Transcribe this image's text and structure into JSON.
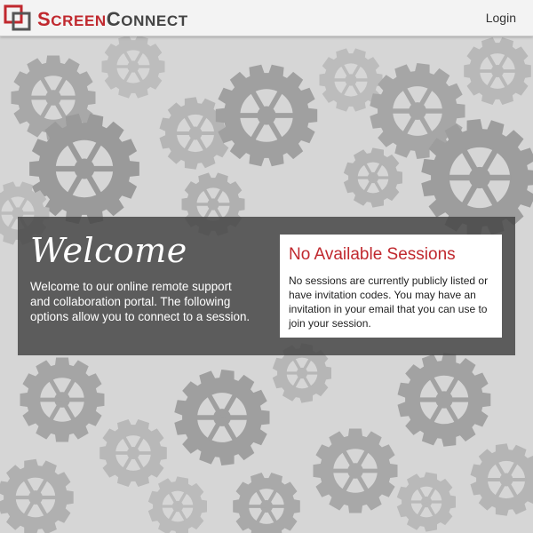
{
  "header": {
    "logo_text": "SCREENCONNECT",
    "login_label": "Login"
  },
  "welcome": {
    "title": "Welcome",
    "text": "Welcome to our online remote support and collaboration portal. The following options allow you to connect to a session."
  },
  "sessions": {
    "title": "No Available Sessions",
    "text": "No sessions are currently publicly listed or have invitation codes. You may have an invitation in your email that you can use to join your session."
  },
  "colors": {
    "brand_red": "#c0282e",
    "panel_bg": "#464646",
    "page_bg": "#d6d6d6"
  }
}
